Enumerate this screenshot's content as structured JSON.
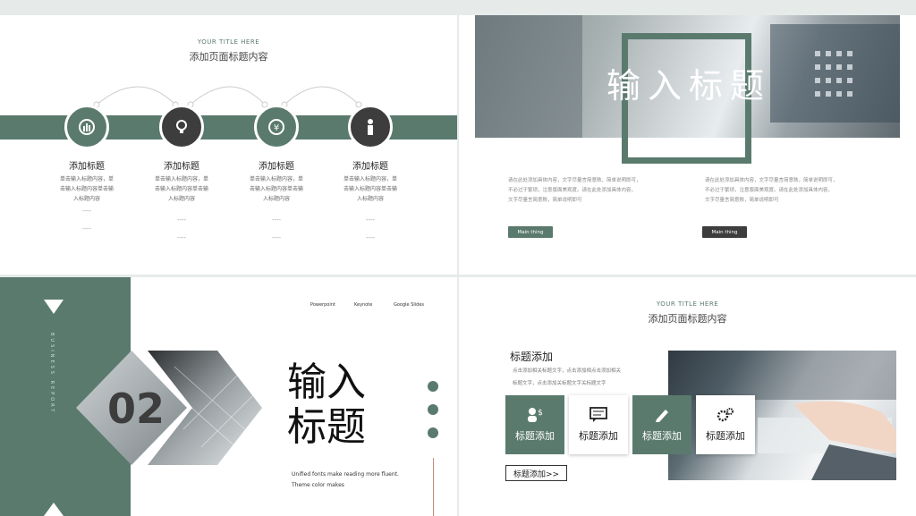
{
  "slide1": {
    "subtitle": "YOUR TITLE HERE",
    "title": "添加页面标题内容",
    "features": [
      {
        "title": "添加标题",
        "desc1": "单击输入标题内容，单",
        "desc2": "击输入标题内容单击输",
        "desc3": "入标题内容",
        "dots1": "----",
        "dots2": "----",
        "icon": "chart-icon"
      },
      {
        "title": "添加标题",
        "desc1": "单击输入标题内容，单",
        "desc2": "击输入标题内容单击输",
        "desc3": "入标题内容",
        "dots1": "----",
        "dots2": "----",
        "icon": "bulb-icon"
      },
      {
        "title": "添加标题",
        "desc1": "单击输入标题内容，单",
        "desc2": "击输入标题内容单击输",
        "desc3": "入标题内容",
        "dots1": "----",
        "dots2": "----",
        "icon": "yen-icon"
      },
      {
        "title": "添加标题",
        "desc1": "单击输入标题内容，单",
        "desc2": "击输入标题内容单击输",
        "desc3": "入标题内容",
        "dots1": "----",
        "dots2": "----",
        "icon": "person-icon"
      }
    ]
  },
  "slide2": {
    "title": "输入标题",
    "col1": {
      "line1": "请在此处添加具体内容，文字尽量言简意赅，简单说明即可，",
      "line2": "不必过于繁琐，注意版面美观度。请在此处添加具体内容，",
      "line3": "文字尽量言简意赅，简单说明即可",
      "button": "Main thing"
    },
    "col2": {
      "line1": "请在此处添加具体内容，文字尽量言简意赅，简单说明即可，",
      "line2": "不必过于繁琐，注意版面美观度。请在此处添加具体内容，",
      "line3": "文字尽量言简意赅，简单说明即可",
      "button": "Main thing"
    }
  },
  "slide3": {
    "vertical_text": "BUSINESS REPORT",
    "number": "02",
    "title_line1": "输入",
    "title_line2": "标题",
    "links": [
      "Powerpoint",
      "Keynote",
      "Google Slides"
    ],
    "note1": "Unified fonts make reading more fluent.",
    "note2": "Theme color makes"
  },
  "slide4": {
    "subtitle": "YOUR TITLE HERE",
    "title": "添加页面标题内容",
    "heading": "标题添加",
    "desc1": "点击添加相关标题文字，点击添加相点击添加相关",
    "desc2": "标题文字，点击添加关标题文字关标题文字",
    "cards": [
      {
        "label": "标题添加",
        "icon": "money-user-icon"
      },
      {
        "label": "标题添加",
        "icon": "message-icon"
      },
      {
        "label": "标题添加",
        "icon": "pen-icon"
      },
      {
        "label": "标题添加",
        "icon": "gears-icon"
      }
    ],
    "more_button": "标题添加>>"
  },
  "colors": {
    "accent": "#5b7a6e",
    "dark": "#3d3d3d"
  }
}
